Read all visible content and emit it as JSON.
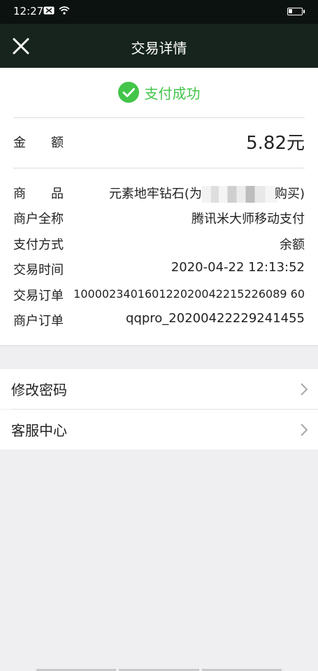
{
  "status_bar": {
    "time": "12:27"
  },
  "header": {
    "title": "交易详情"
  },
  "result": {
    "status_text": "支付成功"
  },
  "amount": {
    "label": "金　　额",
    "value": "5.82元"
  },
  "details": [
    {
      "key": "商　　品",
      "value_prefix": "元素地牢钻石(为",
      "value_suffix": "购买)"
    },
    {
      "key": "商户全称",
      "value": "腾讯米大师移动支付"
    },
    {
      "key": "支付方式",
      "value": "余额"
    },
    {
      "key": "交易时间",
      "value": "2020-04-22 12:13:52"
    },
    {
      "key": "交易订单",
      "value": "100002340160122020042215226089 60"
    },
    {
      "key": "商户订单",
      "value": "qqpro_20200422229241455"
    }
  ],
  "menu": [
    {
      "label": "修改密码"
    },
    {
      "label": "客服中心"
    }
  ],
  "colors": {
    "accent_green": "#43c54a",
    "header_bg": "#16241d"
  }
}
